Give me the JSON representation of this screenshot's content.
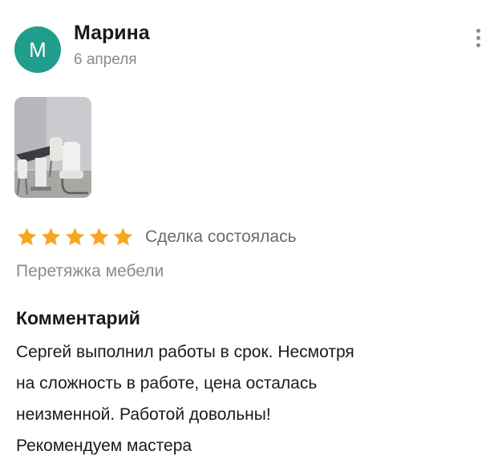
{
  "review": {
    "author": {
      "initial": "М",
      "name": "Марина",
      "avatar_color": "#1e9e8b"
    },
    "date": "6 апреля",
    "menu_icon": "more-vertical-icon",
    "photos": [
      {
        "icon": "photo-thumbnail"
      }
    ],
    "rating": {
      "stars": 5,
      "max": 5,
      "star_color": "#f6a623"
    },
    "deal_status": "Сделка состоялась",
    "service": "Перетяжка мебели",
    "comment": {
      "heading": "Комментарий",
      "lines": [
        "Сергей выполнил работы в срок. Несмотря",
        "на сложность в работе, цена осталась",
        "неизменной. Работой довольны!",
        "Рекомендуем мастера"
      ]
    }
  }
}
